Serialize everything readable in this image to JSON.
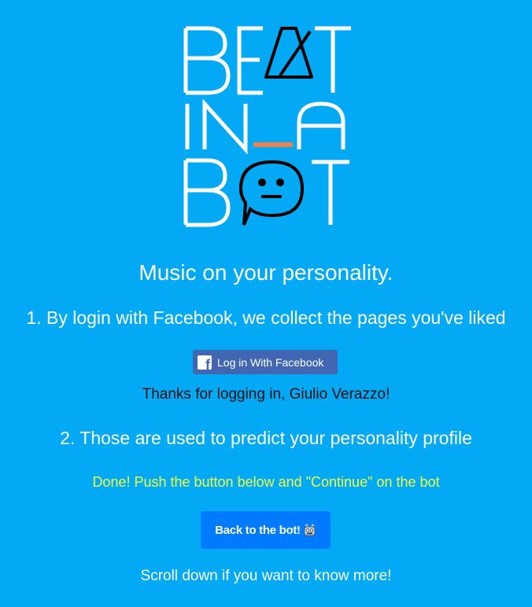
{
  "logo": {
    "line1": "BEAT",
    "line2": "IN_A",
    "line3": "BOT",
    "accent_color": "#f07f4a"
  },
  "tagline": "Music on your personality.",
  "step1": "1. By login with Facebook, we collect the pages you've liked",
  "facebook_button": {
    "icon": "facebook-icon",
    "label": "Log in With Facebook",
    "color": "#4267b2"
  },
  "thanks": "Thanks for logging in, Giulio Verazzo!",
  "step2": "2. Those are used to predict your personality profile",
  "done_message": "Done! Push the button below and \"Continue\" on the bot",
  "bot_button": {
    "label": "Back to the bot!",
    "icon": "robot-emoji-icon",
    "color": "#007bff"
  },
  "scroll_hint": "Scroll down if you want to know more!",
  "colors": {
    "background": "#03a9f4",
    "highlight": "#eeff41"
  }
}
